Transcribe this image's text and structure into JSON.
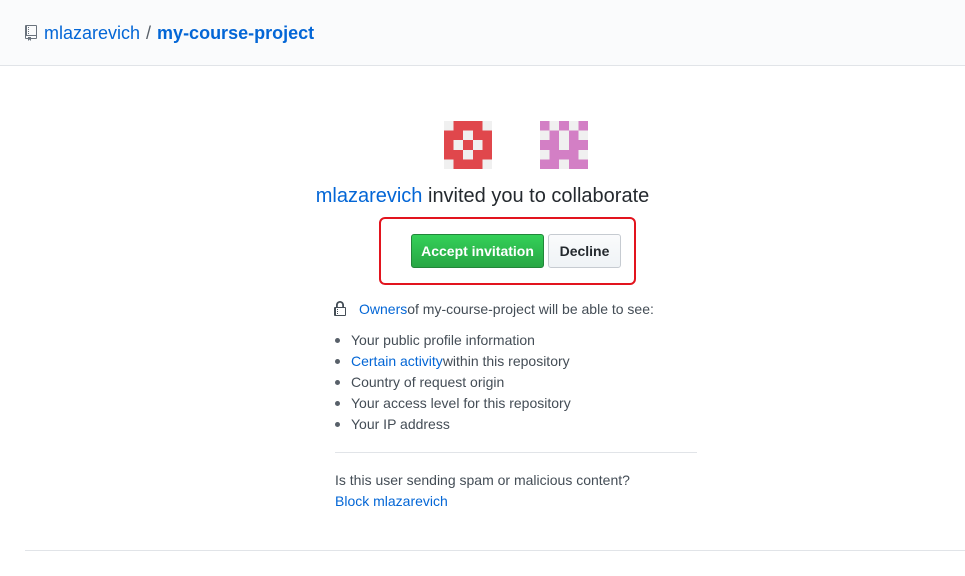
{
  "header": {
    "repo_icon": "repo-icon",
    "owner": "mlazarevich",
    "separator": "/",
    "repo": "my-course-project"
  },
  "avatars": {
    "inviter_icon": "identicon-red",
    "invitee_icon": "identicon-pink",
    "inviter_color": "#e0474c",
    "invitee_color": "#d37fc5"
  },
  "invitation": {
    "inviter": "mlazarevich",
    "message": " invited you to collaborate",
    "accept_label": "Accept invitation",
    "decline_label": "Decline",
    "highlight_color": "#e2141e"
  },
  "visibility": {
    "lock_icon": "lock-icon",
    "owners_link": "Owners",
    "intro_rest": " of my-course-project will be able to see:",
    "items": [
      {
        "link": "",
        "text": "Your public profile information"
      },
      {
        "link": "Certain activity",
        "text": " within this repository"
      },
      {
        "link": "",
        "text": "Country of request origin"
      },
      {
        "link": "",
        "text": "Your access level for this repository"
      },
      {
        "link": "",
        "text": "Your IP address"
      }
    ]
  },
  "spam": {
    "question": "Is this user sending spam or malicious content?",
    "block_link": "Block mlazarevich"
  },
  "colors": {
    "link": "#0366d6",
    "accept_green": "#28a745"
  }
}
